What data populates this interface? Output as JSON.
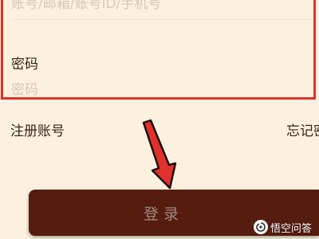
{
  "login_form": {
    "account_placeholder": "账号/邮箱/账号ID/手机号",
    "password_label": "密码",
    "password_placeholder": "密码",
    "register_link": "注册账号",
    "forgot_link": "忘记密",
    "login_button": "登录"
  },
  "watermark": {
    "text": "悟空问答"
  },
  "colors": {
    "background": "#fbf1de",
    "highlight": "#e0312c",
    "button": "#561c0f",
    "button_text": "#a08a7f"
  }
}
